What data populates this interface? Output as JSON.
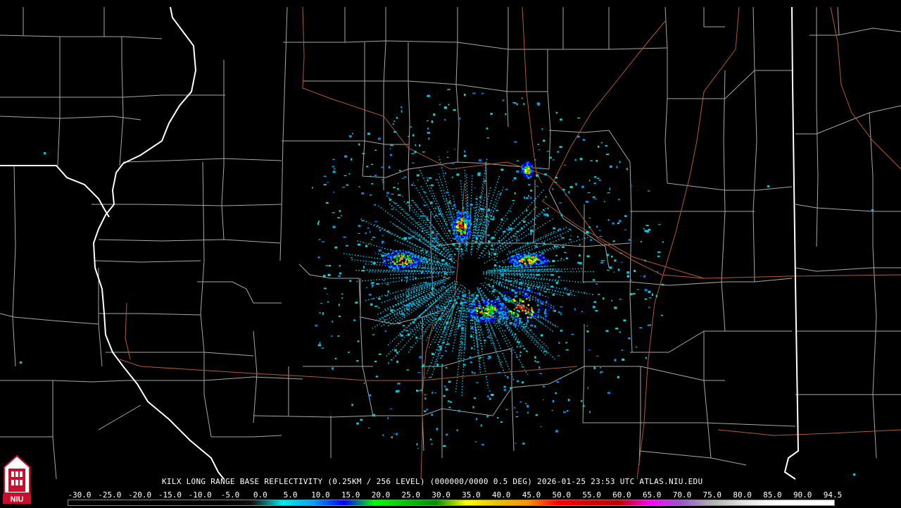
{
  "caption": "KILX LONG RANGE BASE REFLECTIVITY (0.25KM / 256 LEVEL) (000000/0000 0.5 DEG) 2026-01-25 23:53 UTC  ATLAS.NIU.EDU",
  "logo": {
    "text": "NIU",
    "icon": "niu-tower-logo",
    "color": "#c8102e"
  },
  "scale": {
    "ticks": [
      "-30.0",
      "-25.0",
      "-20.0",
      "-15.0",
      "-10.0",
      "-5.0",
      "0.0",
      "5.0",
      "10.0",
      "15.0",
      "20.0",
      "25.0",
      "30.0",
      "35.0",
      "40.0",
      "45.0",
      "50.0",
      "55.0",
      "60.0",
      "65.0",
      "70.0",
      "75.0",
      "80.0",
      "85.0",
      "90.0",
      "94.5"
    ],
    "colors": [
      "#000000",
      "#000000",
      "#000000",
      "#000000",
      "#000000",
      "#000000",
      "#111111",
      "#00ecec",
      "#01a0f6",
      "#0000f6",
      "#00ff00",
      "#00c800",
      "#009000",
      "#ffff00",
      "#e7c000",
      "#ff9000",
      "#ff0000",
      "#d60000",
      "#c00000",
      "#ff00ff",
      "#9955c9",
      "#b0b0b0",
      "#e0e0e0",
      "#ffffff",
      "#ffffff",
      "#ffffff"
    ]
  },
  "map_colors": {
    "state": "#ffffff",
    "county": "#a6a6a6",
    "road": "#b05a2e",
    "background": "#000000"
  }
}
